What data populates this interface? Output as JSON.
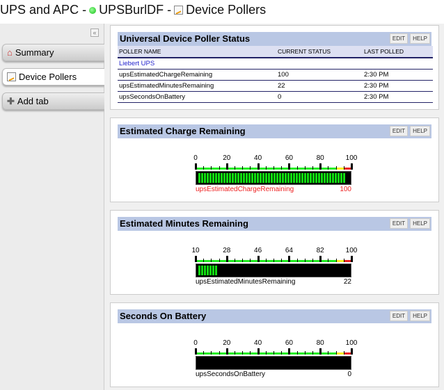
{
  "header": {
    "part1": "UPS and APC -",
    "node": "UPSBurlDF -",
    "view": "Device Pollers"
  },
  "sidebar": {
    "collapse": "«",
    "tabs": [
      {
        "label": "Summary"
      },
      {
        "label": "Device Pollers"
      },
      {
        "label": "Add tab"
      }
    ]
  },
  "status_panel": {
    "title": "Universal Device Poller Status",
    "edit": "EDIT",
    "help": "HELP",
    "columns": [
      "POLLER NAME",
      "CURRENT STATUS",
      "LAST POLLED"
    ],
    "group": "Liebert UPS",
    "rows": [
      [
        "upsEstimatedChargeRemaining",
        "100",
        "2:30 PM"
      ],
      [
        "upsEstimatedMinutesRemaining",
        "22",
        "2:30 PM"
      ],
      [
        "upsSecondsOnBattery",
        "0",
        "2:30 PM"
      ]
    ]
  },
  "gauges": [
    {
      "title": "Estimated Charge Remaining",
      "edit": "EDIT",
      "help": "HELP",
      "ticks": [
        "0",
        "20",
        "40",
        "60",
        "80",
        "100"
      ],
      "min": 0,
      "max": 100,
      "value": 100,
      "label": "upsEstimatedChargeRemaining",
      "value_text": "100",
      "alert": true
    },
    {
      "title": "Estimated Minutes Remaining",
      "edit": "EDIT",
      "help": "HELP",
      "ticks": [
        "10",
        "28",
        "46",
        "64",
        "82",
        "100"
      ],
      "min": 10,
      "max": 100,
      "value": 22,
      "label": "upsEstimatedMinutesRemaining",
      "value_text": "22",
      "alert": false
    },
    {
      "title": "Seconds On Battery",
      "edit": "EDIT",
      "help": "HELP",
      "ticks": [
        "0",
        "20",
        "40",
        "60",
        "80",
        "100"
      ],
      "min": 0,
      "max": 100,
      "value": 0,
      "label": "upsSecondsOnBattery",
      "value_text": "0",
      "alert": false
    }
  ],
  "colors": {
    "green": "#22ee22",
    "yellow": "#ffee22",
    "red": "#ee2222"
  }
}
